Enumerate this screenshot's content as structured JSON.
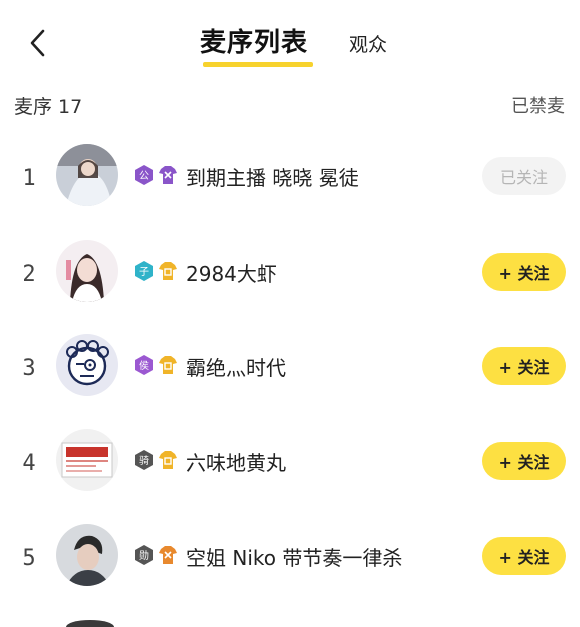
{
  "header": {
    "back_icon": "chevron-left-icon",
    "tab_active": "麦序列表",
    "tab_other": "观众",
    "accent_color": "#f7d22d"
  },
  "subheader": {
    "queue_label": "麦序 17",
    "muted_label": "已禁麦"
  },
  "list": [
    {
      "rank": "1",
      "name": "到期主播 晓晓 冕徒",
      "badge1_char": "公",
      "badge1_color": "#8a55c9",
      "badge2_color": "#8a55c9",
      "button": "已关注",
      "followed": true
    },
    {
      "rank": "2",
      "name": "2984大虾",
      "badge1_char": "子",
      "badge1_color": "#2fb3c9",
      "badge2_color": "#f0b429",
      "button": "+ 关注",
      "followed": false
    },
    {
      "rank": "3",
      "name": "霸绝灬时代",
      "badge1_char": "侯",
      "badge1_color": "#9b58d1",
      "badge2_color": "#f0b429",
      "button": "+ 关注",
      "followed": false
    },
    {
      "rank": "4",
      "name": "六味地黄丸",
      "badge1_char": "骑",
      "badge1_color": "#555555",
      "badge2_color": "#f0b429",
      "button": "+ 关注",
      "followed": false
    },
    {
      "rank": "5",
      "name": "空姐 Niko 带节奏一律杀",
      "badge1_char": "勋",
      "badge1_color": "#555555",
      "badge2_color": "#e8892e",
      "button": "+ 关注",
      "followed": false
    }
  ]
}
